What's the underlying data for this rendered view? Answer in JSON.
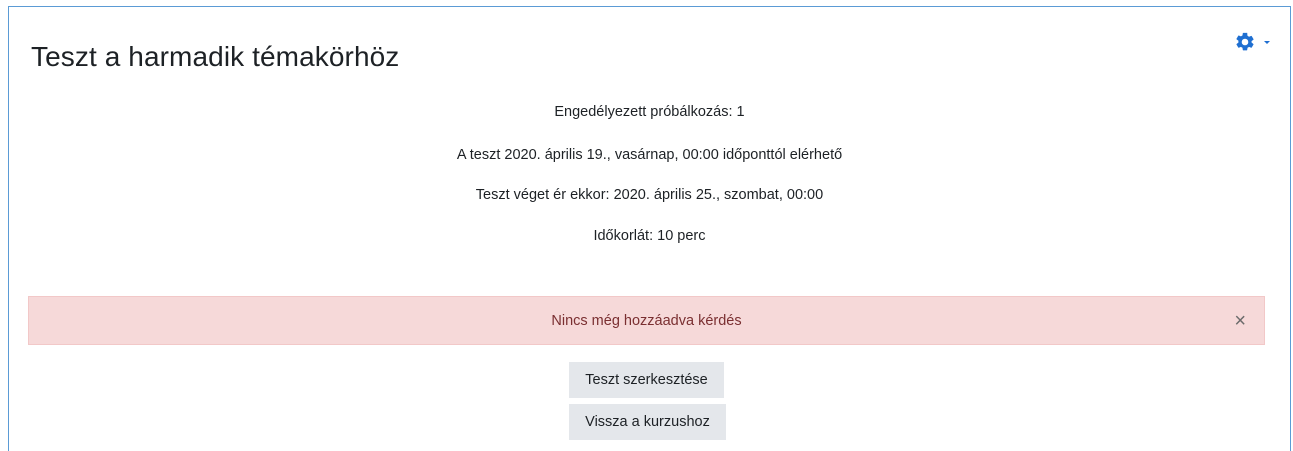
{
  "quiz": {
    "title": "Teszt a harmadik témakörhöz",
    "info": {
      "attempts": "Engedélyezett próbálkozás: 1",
      "opens": "A teszt 2020. április 19., vasárnap, 00:00 időponttól elérhető",
      "closes": "Teszt véget ér ekkor: 2020. április 25., szombat, 00:00",
      "time_limit": "Időkorlát: 10 perc"
    },
    "alert": {
      "message": "Nincs még hozzáadva kérdés",
      "close_symbol": "×"
    },
    "buttons": {
      "edit": "Teszt szerkesztése",
      "back": "Vissza a kurzushoz"
    }
  },
  "icons": {
    "settings": "gear-icon",
    "settings_dropdown": "caret-down-icon",
    "close": "close-icon"
  },
  "colors": {
    "accent": "#1f6fd1",
    "border": "#5b9bd5",
    "alert_background": "#f6d9d9",
    "alert_text": "#7a2f31",
    "button_background": "#e4e7eb"
  }
}
